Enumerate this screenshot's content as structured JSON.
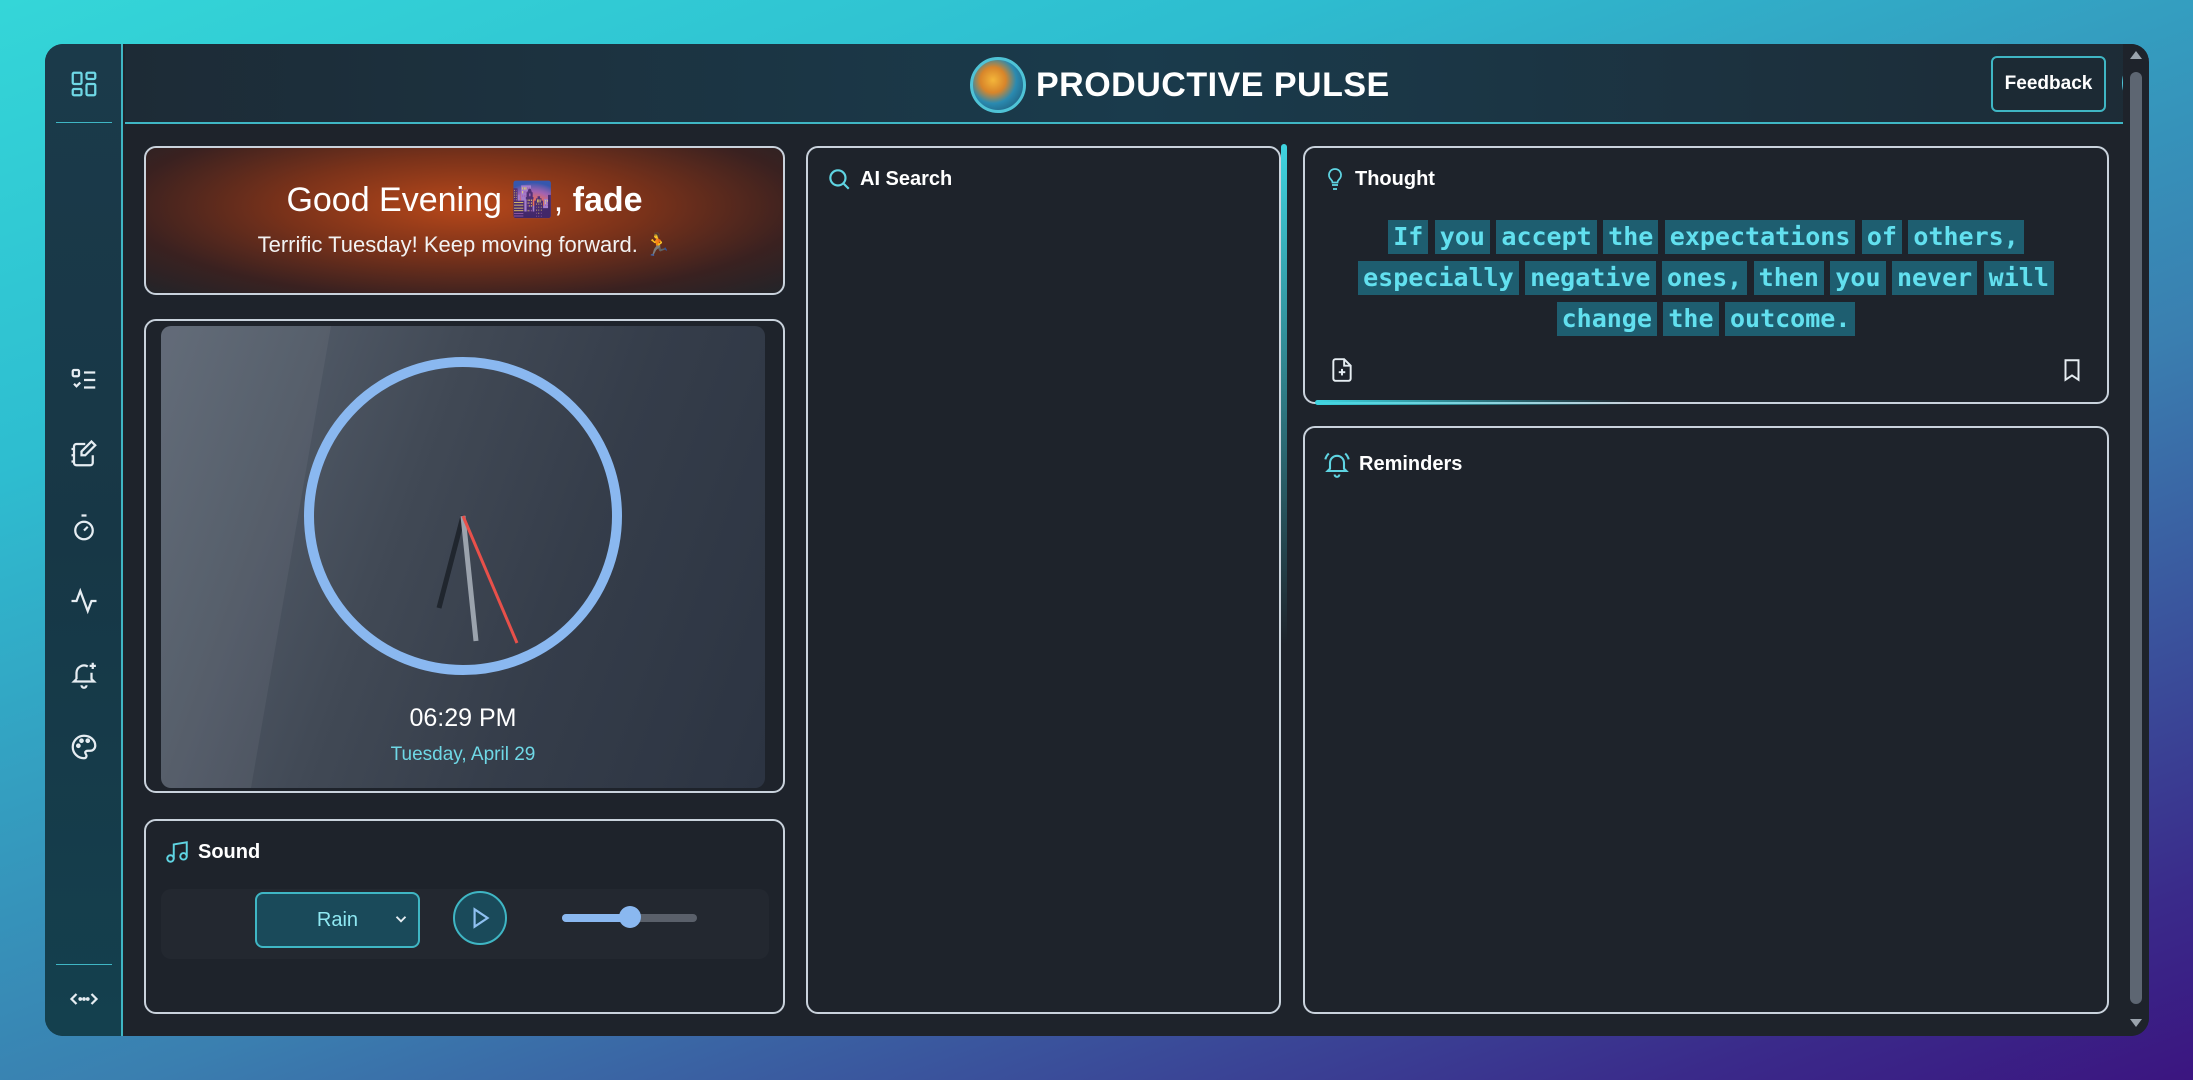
{
  "app": {
    "title": "PRODUCTIVE PULSE",
    "feedback_label": "Feedback"
  },
  "sidebar": {
    "items": [
      {
        "icon": "dashboard-icon"
      },
      {
        "icon": "tasks-list-icon"
      },
      {
        "icon": "notes-edit-icon"
      },
      {
        "icon": "timer-icon"
      },
      {
        "icon": "activity-pulse-icon"
      },
      {
        "icon": "bell-plus-icon"
      },
      {
        "icon": "palette-icon"
      },
      {
        "icon": "expand-icon"
      }
    ]
  },
  "greeting": {
    "text": "Good Evening",
    "emoji": "🌆",
    "name": "fade",
    "subtitle": "Terrific Tuesday! Keep moving forward. 🏃"
  },
  "clock": {
    "time": "06:29 PM",
    "date": "Tuesday, April 29"
  },
  "sound": {
    "title": "Sound",
    "selected": "Rain",
    "volume": 0.5
  },
  "ai_search": {
    "title": "AI Search"
  },
  "thought": {
    "title": "Thought",
    "quote": "If you accept the expectations of others, especially negative ones, then you never will change the outcome."
  },
  "reminders": {
    "title": "Reminders"
  },
  "colors": {
    "accent": "#3fb6c4",
    "highlight": "#62e0ef"
  }
}
